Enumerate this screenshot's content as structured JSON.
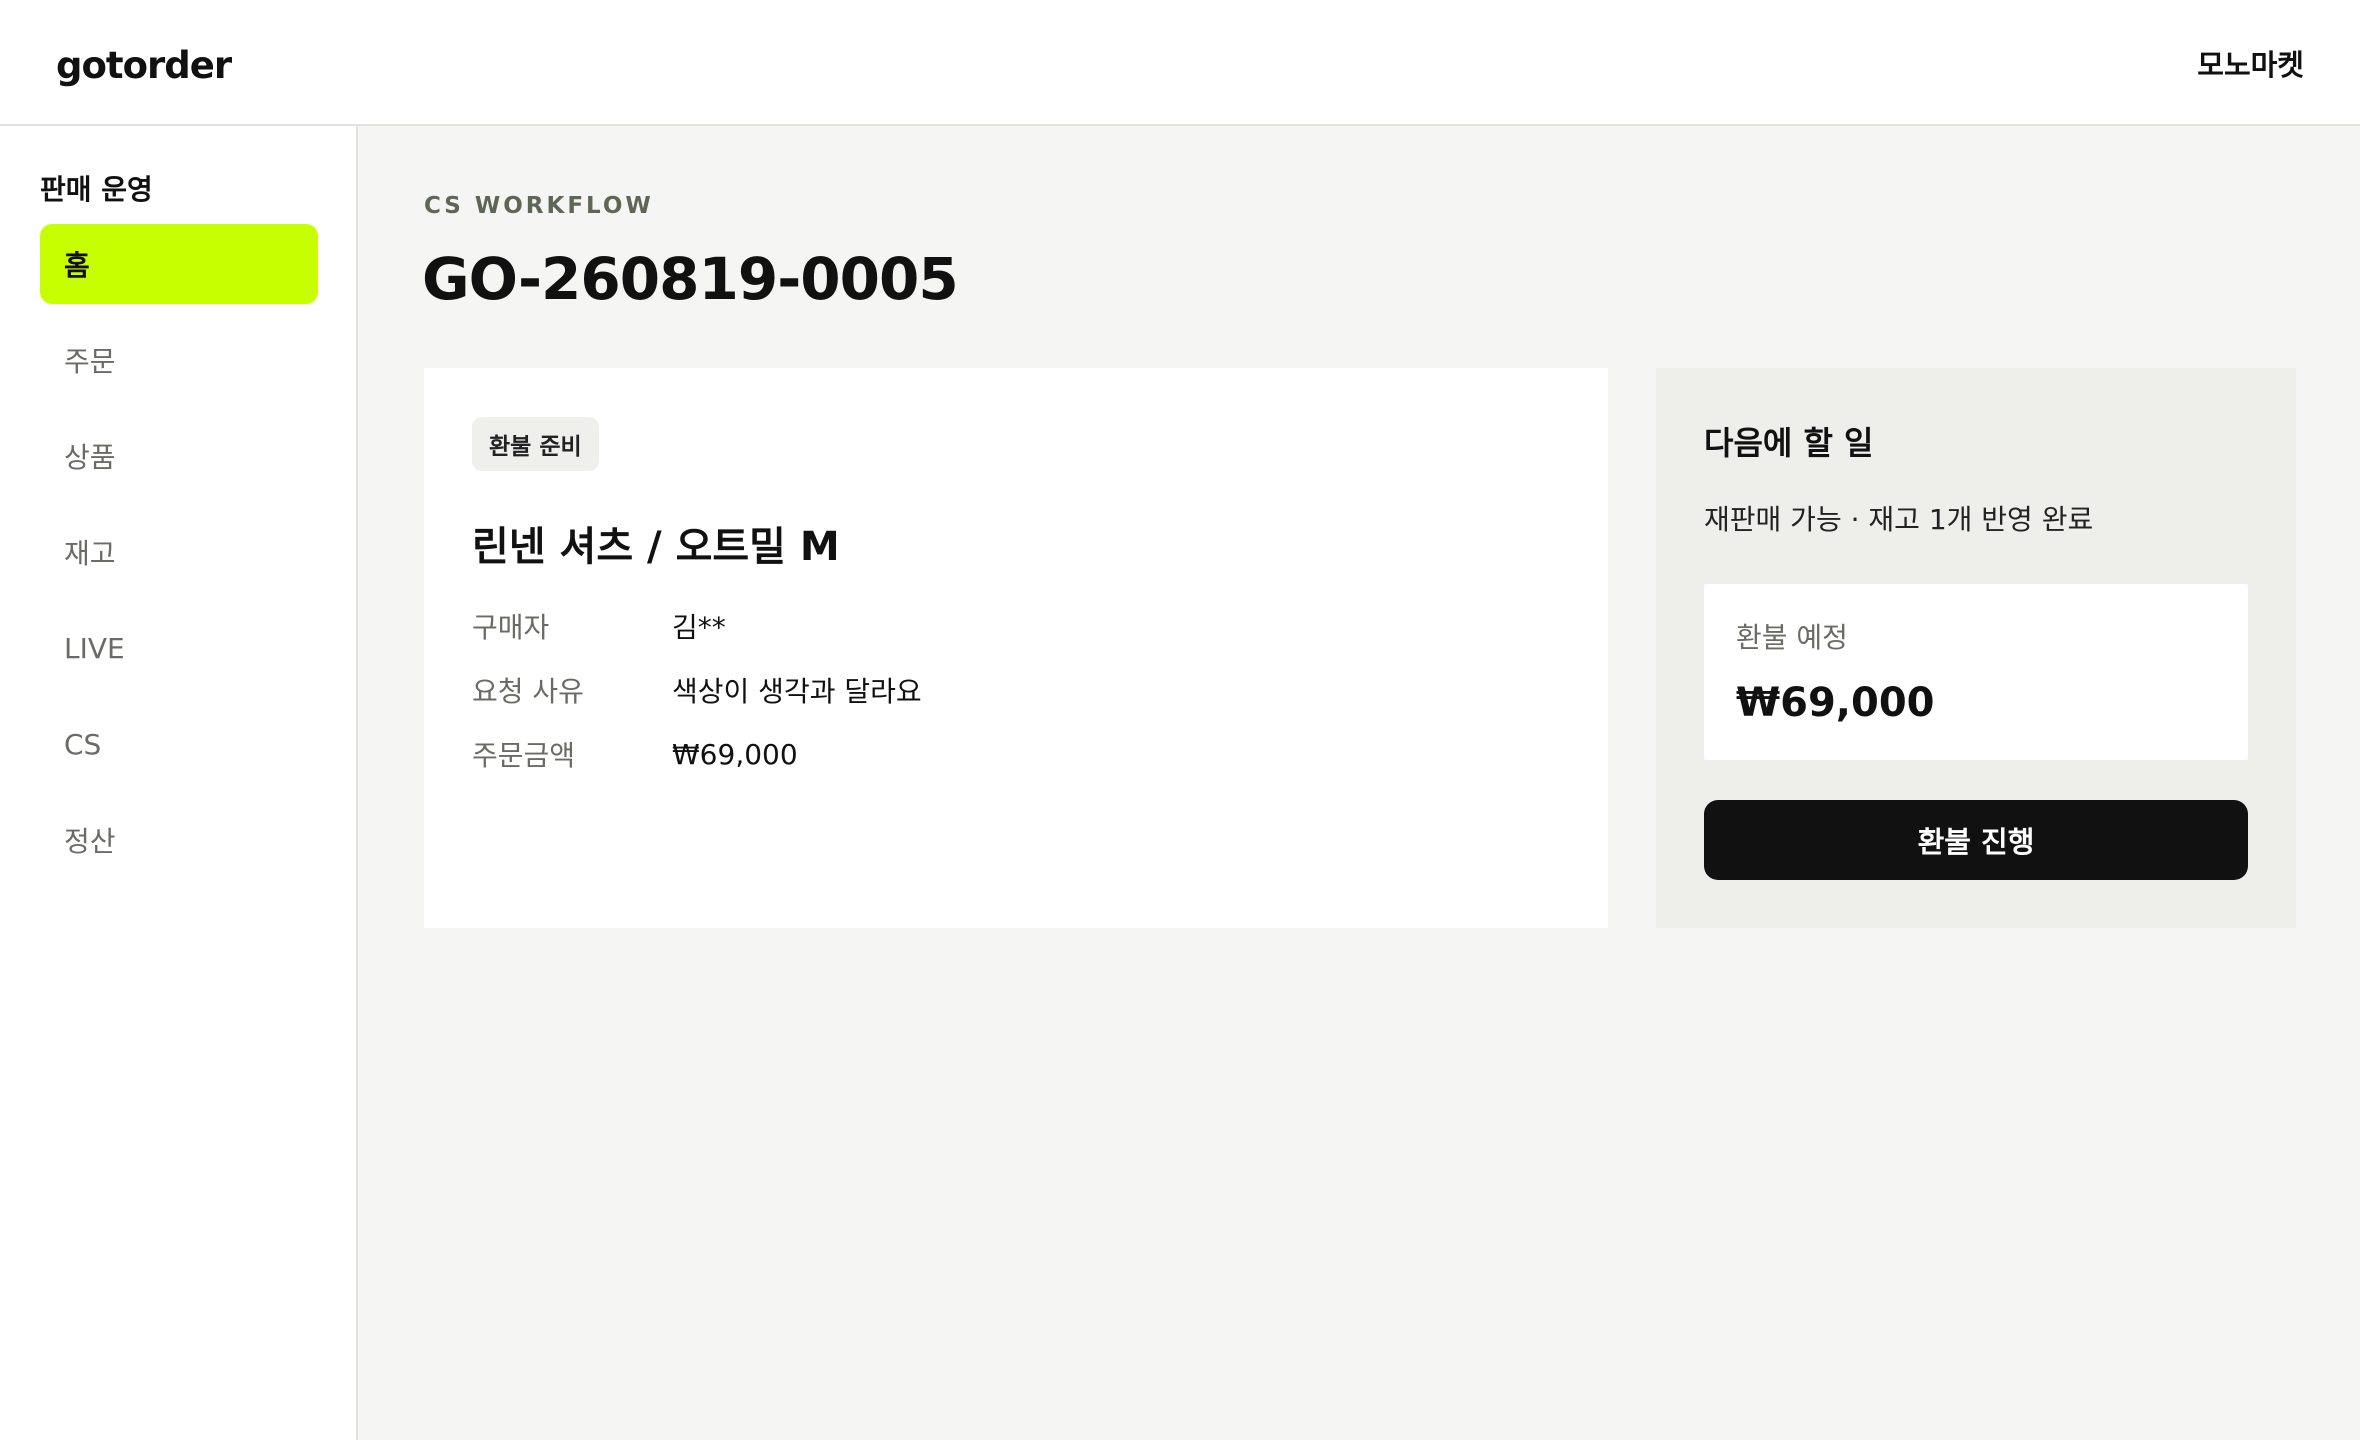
{
  "header": {
    "logo": "gotorder",
    "store_name": "모노마켓"
  },
  "sidebar": {
    "section_title": "판매 운영",
    "items": [
      {
        "label": "홈",
        "active": true
      },
      {
        "label": "주문",
        "active": false
      },
      {
        "label": "상품",
        "active": false
      },
      {
        "label": "재고",
        "active": false
      },
      {
        "label": "LIVE",
        "active": false
      },
      {
        "label": "CS",
        "active": false
      },
      {
        "label": "정산",
        "active": false
      }
    ]
  },
  "main": {
    "eyebrow": "CS WORKFLOW",
    "title": "GO-260819-0005",
    "detail": {
      "status_badge": "환불 준비",
      "product_name": "린넨 셔츠 / 오트밀 M",
      "rows": [
        {
          "label": "구매자",
          "value": "김**"
        },
        {
          "label": "요청 사유",
          "value": "색상이 생각과 달라요"
        },
        {
          "label": "주문금액",
          "value": "₩69,000"
        }
      ]
    },
    "next_step": {
      "title": "다음에 할 일",
      "note": "재판매 가능 · 재고 1개 반영 완료",
      "refund_label": "환불 예정",
      "refund_amount": "₩69,000",
      "action_label": "환불 진행"
    }
  },
  "colors": {
    "accent": "#c8ff00",
    "background": "#f5f5f3",
    "button": "#111111"
  }
}
